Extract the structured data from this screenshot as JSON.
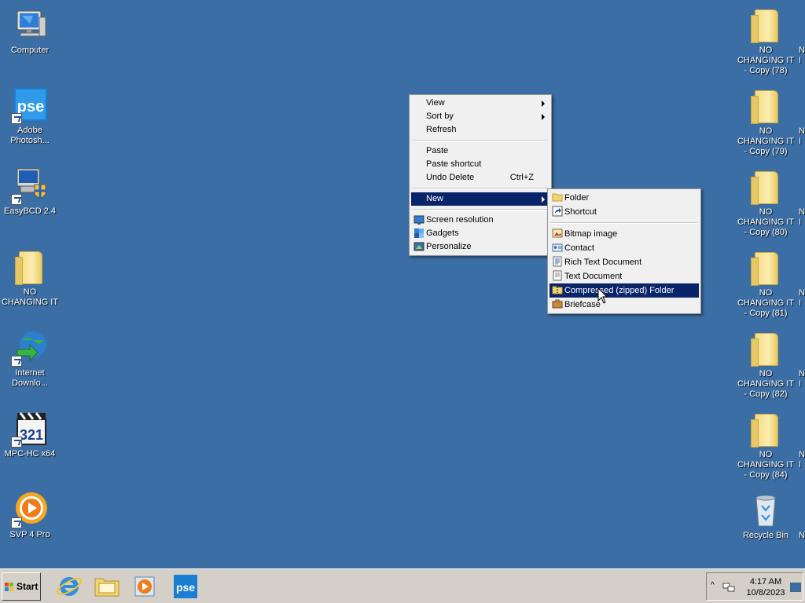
{
  "desktop": {
    "left_icons": [
      {
        "label": "Computer"
      },
      {
        "label": "Adobe Photosh..."
      },
      {
        "label": "EasyBCD 2.4"
      },
      {
        "label": "NO CHANGING IT"
      },
      {
        "label": "Internet Downlo..."
      },
      {
        "label": "MPC-HC x64"
      },
      {
        "label": "SVP 4 Pro"
      }
    ],
    "right_icons": [
      {
        "label": "NO CHANGING IT - Copy (78)"
      },
      {
        "label": "NO CHANGING IT - Copy (79)"
      },
      {
        "label": "NO CHANGING IT - Copy (80)"
      },
      {
        "label": "NO CHANGING IT - Copy (81)"
      },
      {
        "label": "NO CHANGING IT - Copy (82)"
      },
      {
        "label": "NO CHANGING IT - Copy (84)"
      },
      {
        "label": "Recycle Bin"
      }
    ],
    "clipped_labels": [
      "N",
      "I",
      "N",
      "I",
      "N",
      "I",
      "N",
      "I",
      "N",
      "I",
      "N",
      "I",
      "N"
    ]
  },
  "context_menu": {
    "items": {
      "view": "View",
      "sort_by": "Sort by",
      "refresh": "Refresh",
      "paste": "Paste",
      "paste_shortcut": "Paste shortcut",
      "undo_delete": "Undo Delete",
      "undo_shortcut": "Ctrl+Z",
      "new": "New",
      "screen_resolution": "Screen resolution",
      "gadgets": "Gadgets",
      "personalize": "Personalize"
    }
  },
  "new_submenu": {
    "items": {
      "folder": "Folder",
      "shortcut": "Shortcut",
      "bitmap": "Bitmap image",
      "contact": "Contact",
      "rtf": "Rich Text Document",
      "txt": "Text Document",
      "zip": "Compressed (zipped) Folder",
      "briefcase": "Briefcase"
    }
  },
  "taskbar": {
    "start_label": "Start",
    "time": "4:17 AM",
    "date": "10/8/2023",
    "pse_label": "pse"
  },
  "colors": {
    "desktop": "#3a6ea5",
    "menu_highlight": "#0a246a",
    "taskbar": "#d4d0c8"
  }
}
